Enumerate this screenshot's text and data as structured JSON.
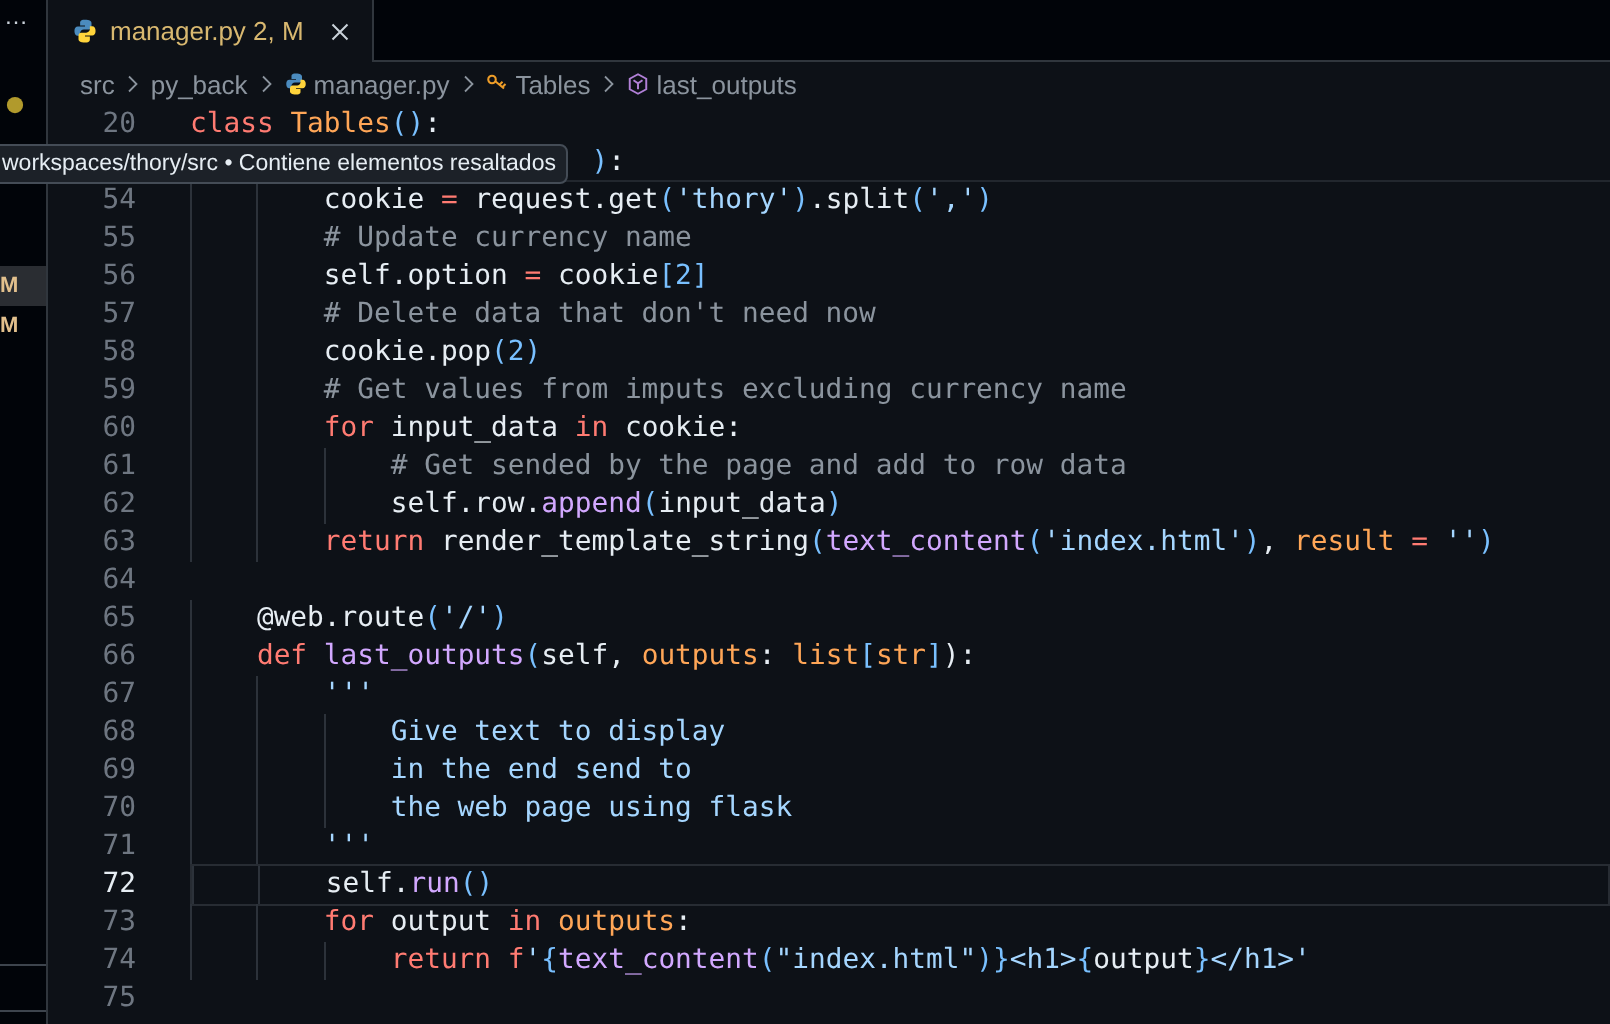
{
  "sidebar": {
    "overflow": "…",
    "badges": [
      {
        "text": "M",
        "selected": true
      },
      {
        "text": "M",
        "selected": false
      }
    ]
  },
  "tab": {
    "label": "manager.py",
    "status": "2, M",
    "selected": true
  },
  "breadcrumbs": [
    {
      "text": "src",
      "kind": "folder"
    },
    {
      "text": "py_back",
      "kind": "folder"
    },
    {
      "text": "manager.py",
      "kind": "file"
    },
    {
      "text": "Tables",
      "kind": "class"
    },
    {
      "text": "last_outputs",
      "kind": "method"
    }
  ],
  "sticky_lines": [
    {
      "number": "20",
      "tokens": [
        {
          "text": "class ",
          "kind": "keyword"
        },
        {
          "text": "Tables",
          "kind": "class"
        },
        {
          "text": "()",
          "kind": "paren"
        },
        {
          "text": ":",
          "kind": "plain"
        }
      ]
    },
    {
      "tokens": [
        {
          "text": ")",
          "kind": "paren"
        },
        {
          "text": ":",
          "kind": "plain"
        }
      ]
    }
  ],
  "tooltip": "workspaces/thory/src • Contiene elementos resaltados",
  "lines": [
    {
      "number": "54",
      "current": false,
      "tokens": [
        {
          "text": "        cookie ",
          "kind": "plain"
        },
        {
          "text": "=",
          "kind": "keyword"
        },
        {
          "text": " request.get",
          "kind": "plain"
        },
        {
          "text": "(",
          "kind": "paren"
        },
        {
          "text": "'thory'",
          "kind": "string"
        },
        {
          "text": ")",
          "kind": "paren"
        },
        {
          "text": ".split",
          "kind": "plain"
        },
        {
          "text": "(",
          "kind": "paren"
        },
        {
          "text": "','",
          "kind": "string"
        },
        {
          "text": ")",
          "kind": "paren"
        }
      ]
    },
    {
      "number": "55",
      "current": false,
      "tokens": [
        {
          "text": "        # Update currency name",
          "kind": "comment"
        }
      ]
    },
    {
      "number": "56",
      "current": false,
      "tokens": [
        {
          "text": "        self.option ",
          "kind": "plain"
        },
        {
          "text": "=",
          "kind": "keyword"
        },
        {
          "text": " cookie",
          "kind": "plain"
        },
        {
          "text": "[2]",
          "kind": "paren"
        }
      ]
    },
    {
      "number": "57",
      "current": false,
      "tokens": [
        {
          "text": "        # Delete data that don't need now",
          "kind": "comment"
        }
      ]
    },
    {
      "number": "58",
      "current": false,
      "tokens": [
        {
          "text": "        cookie.pop",
          "kind": "plain"
        },
        {
          "text": "(2)",
          "kind": "paren"
        }
      ]
    },
    {
      "number": "59",
      "current": false,
      "tokens": [
        {
          "text": "        # Get values from imputs excluding currency name",
          "kind": "comment"
        }
      ]
    },
    {
      "number": "60",
      "current": false,
      "tokens": [
        {
          "text": "        for",
          "kind": "keyword"
        },
        {
          "text": " input_data ",
          "kind": "plain"
        },
        {
          "text": "in",
          "kind": "keyword"
        },
        {
          "text": " cookie:",
          "kind": "plain"
        }
      ]
    },
    {
      "number": "61",
      "current": false,
      "tokens": [
        {
          "text": "            # Get sended by the page and add to row data",
          "kind": "comment"
        }
      ]
    },
    {
      "number": "62",
      "current": false,
      "tokens": [
        {
          "text": "            self.row.",
          "kind": "plain"
        },
        {
          "text": "append",
          "kind": "function"
        },
        {
          "text": "(",
          "kind": "paren"
        },
        {
          "text": "input_data",
          "kind": "plain"
        },
        {
          "text": ")",
          "kind": "paren"
        }
      ]
    },
    {
      "number": "63",
      "current": false,
      "tokens": [
        {
          "text": "        return",
          "kind": "keyword"
        },
        {
          "text": " render_template_string",
          "kind": "plain"
        },
        {
          "text": "(",
          "kind": "paren"
        },
        {
          "text": "text_content",
          "kind": "function"
        },
        {
          "text": "(",
          "kind": "paren"
        },
        {
          "text": "'index.html'",
          "kind": "string"
        },
        {
          "text": ")",
          "kind": "paren"
        },
        {
          "text": ", ",
          "kind": "plain"
        },
        {
          "text": "result",
          "kind": "param"
        },
        {
          "text": " = ",
          "kind": "keyword"
        },
        {
          "text": "''",
          "kind": "string"
        },
        {
          "text": ")",
          "kind": "paren"
        }
      ]
    },
    {
      "number": "64",
      "current": false
    },
    {
      "number": "65",
      "current": false,
      "tokens": [
        {
          "text": "    @web.route",
          "kind": "plain"
        },
        {
          "text": "(",
          "kind": "paren"
        },
        {
          "text": "'/'",
          "kind": "string"
        },
        {
          "text": ")",
          "kind": "paren"
        }
      ]
    },
    {
      "number": "66",
      "current": false,
      "tokens": [
        {
          "text": "    def",
          "kind": "keyword"
        },
        {
          "text": " last_outputs",
          "kind": "function"
        },
        {
          "text": "(",
          "kind": "paren"
        },
        {
          "text": "self, ",
          "kind": "plain"
        },
        {
          "text": "outputs",
          "kind": "param"
        },
        {
          "text": ": ",
          "kind": "plain"
        },
        {
          "text": "list",
          "kind": "class"
        },
        {
          "text": "[",
          "kind": "paren"
        },
        {
          "text": "str",
          "kind": "class"
        },
        {
          "text": "]",
          "kind": "paren"
        },
        {
          "text": "):",
          "kind": "plain"
        }
      ]
    },
    {
      "number": "67",
      "current": false,
      "tokens": [
        {
          "text": "        '''",
          "kind": "string"
        }
      ]
    },
    {
      "number": "68",
      "current": false,
      "tokens": [
        {
          "text": "            Give text to display",
          "kind": "string"
        }
      ]
    },
    {
      "number": "69",
      "current": false,
      "tokens": [
        {
          "text": "            in the end send to",
          "kind": "string"
        }
      ]
    },
    {
      "number": "70",
      "current": false,
      "tokens": [
        {
          "text": "            the web page using flask",
          "kind": "string"
        }
      ]
    },
    {
      "number": "71",
      "current": false,
      "tokens": [
        {
          "text": "        '''",
          "kind": "string"
        }
      ]
    },
    {
      "number": "72",
      "current": true,
      "tokens": [
        {
          "text": "        self.",
          "kind": "plain"
        },
        {
          "text": "run",
          "kind": "function"
        },
        {
          "text": "()",
          "kind": "paren"
        }
      ]
    },
    {
      "number": "73",
      "current": false,
      "tokens": [
        {
          "text": "        for",
          "kind": "keyword"
        },
        {
          "text": " output ",
          "kind": "plain"
        },
        {
          "text": "in",
          "kind": "keyword"
        },
        {
          "text": " outputs",
          "kind": "param"
        },
        {
          "text": ":",
          "kind": "plain"
        }
      ]
    },
    {
      "number": "74",
      "current": false,
      "tokens": [
        {
          "text": "            return f",
          "kind": "keyword"
        },
        {
          "text": "'",
          "kind": "string"
        },
        {
          "text": "{",
          "kind": "paren"
        },
        {
          "text": "text_content",
          "kind": "function"
        },
        {
          "text": "(",
          "kind": "paren"
        },
        {
          "text": "\"index.html\"",
          "kind": "string"
        },
        {
          "text": ")}",
          "kind": "paren"
        },
        {
          "text": "<h1>",
          "kind": "string"
        },
        {
          "text": "{",
          "kind": "paren"
        },
        {
          "text": "output",
          "kind": "plain"
        },
        {
          "text": "}",
          "kind": "paren"
        },
        {
          "text": "</h1>'",
          "kind": "string"
        }
      ]
    },
    {
      "number": "75",
      "current": false
    }
  ]
}
